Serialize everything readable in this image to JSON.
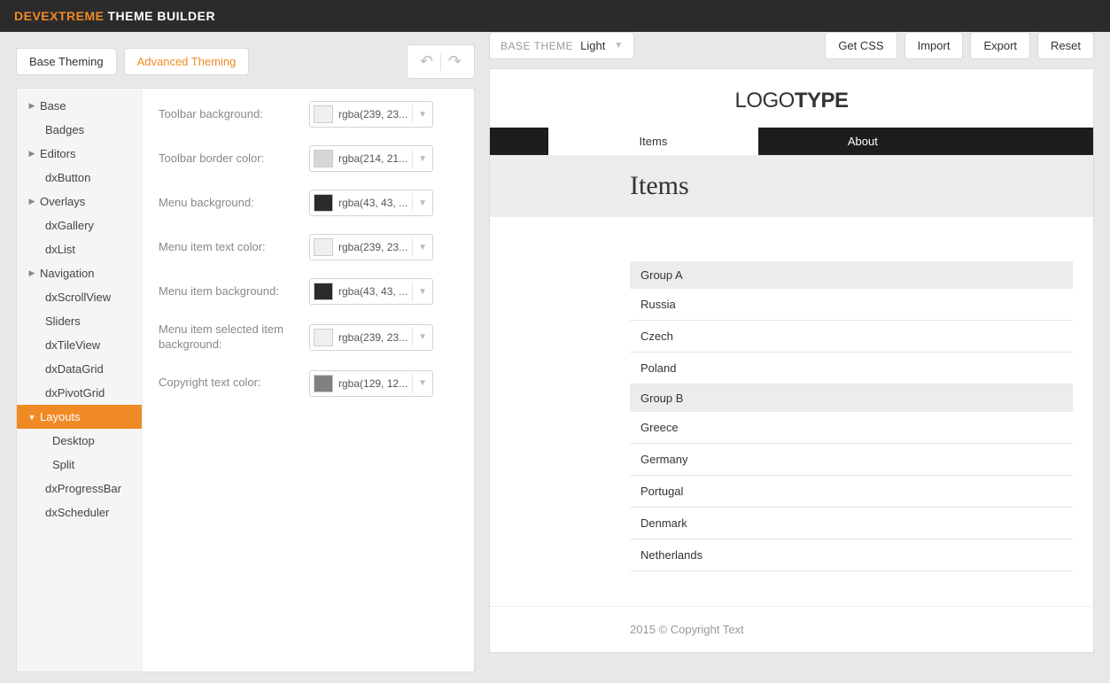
{
  "header": {
    "brand1": "DEVEXTREME",
    "brand2": "THEME BUILDER"
  },
  "toolbar": {
    "base_theming": "Base Theming",
    "advanced_theming": "Advanced Theming",
    "base_theme_label": "BASE THEME",
    "base_theme_value": "Light",
    "get_css": "Get CSS",
    "import": "Import",
    "export": "Export",
    "reset": "Reset"
  },
  "sidebar": {
    "base": "Base",
    "badges": "Badges",
    "editors": "Editors",
    "dxButton": "dxButton",
    "overlays": "Overlays",
    "dxGallery": "dxGallery",
    "dxList": "dxList",
    "navigation": "Navigation",
    "dxScrollView": "dxScrollView",
    "sliders": "Sliders",
    "dxTileView": "dxTileView",
    "dxDataGrid": "dxDataGrid",
    "dxPivotGrid": "dxPivotGrid",
    "layouts": "Layouts",
    "desktop": "Desktop",
    "split": "Split",
    "dxProgressBar": "dxProgressBar",
    "dxScheduler": "dxScheduler"
  },
  "props": {
    "toolbar_bg": {
      "label": "Toolbar background:",
      "value": "rgba(239, 23...",
      "swatch": "#efefef"
    },
    "toolbar_border": {
      "label": "Toolbar border color:",
      "value": "rgba(214, 21...",
      "swatch": "#d6d6d6"
    },
    "menu_bg": {
      "label": "Menu background:",
      "value": "rgba(43, 43, ...",
      "swatch": "#2b2b2b"
    },
    "menu_item_text": {
      "label": "Menu item text color:",
      "value": "rgba(239, 23...",
      "swatch": "#efefef"
    },
    "menu_item_bg": {
      "label": "Menu item background:",
      "value": "rgba(43, 43, ...",
      "swatch": "#2b2b2b"
    },
    "menu_item_sel_bg": {
      "label": "Menu item selected item background:",
      "value": "rgba(239, 23...",
      "swatch": "#efefef"
    },
    "copyright_color": {
      "label": "Copyright text color:",
      "value": "rgba(129, 12...",
      "swatch": "#818181"
    }
  },
  "preview": {
    "logo1": "LOGO",
    "logo2": "TYPE",
    "tab_items": "Items",
    "tab_about": "About",
    "page_title": "Items",
    "group_a": "Group A",
    "group_b": "Group B",
    "items_a": [
      "Russia",
      "Czech",
      "Poland"
    ],
    "items_b": [
      "Greece",
      "Germany",
      "Portugal",
      "Denmark",
      "Netherlands"
    ],
    "copyright": "2015 © Copyright Text"
  }
}
